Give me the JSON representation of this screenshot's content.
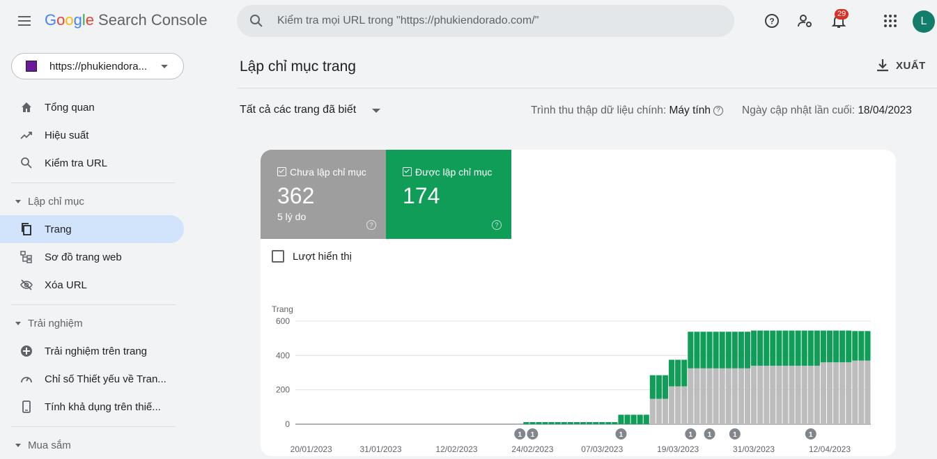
{
  "header": {
    "logo_google": [
      "G",
      "o",
      "o",
      "g",
      "l",
      "e"
    ],
    "logo_product": "Search Console",
    "search_placeholder": "Kiểm tra mọi URL trong \"https://phukiendorado.com/\"",
    "notification_count": "29",
    "avatar_letter": "L"
  },
  "sidebar": {
    "property": "https://phukiendora...",
    "items_top": [
      {
        "label": "Tổng quan",
        "icon": "home-icon"
      },
      {
        "label": "Hiệu suất",
        "icon": "trending-up-icon"
      },
      {
        "label": "Kiểm tra URL",
        "icon": "search-icon"
      }
    ],
    "section_index": "Lập chỉ mục",
    "items_index": [
      {
        "label": "Trang",
        "icon": "pages-icon"
      },
      {
        "label": "Sơ đồ trang web",
        "icon": "sitemap-icon"
      },
      {
        "label": "Xóa URL",
        "icon": "visibility-off-icon"
      }
    ],
    "section_experience": "Trải nghiệm",
    "items_experience": [
      {
        "label": "Trải nghiệm trên trang",
        "icon": "add-circle-icon"
      },
      {
        "label": "Chỉ số Thiết yếu về Tran...",
        "icon": "speed-icon"
      },
      {
        "label": "Tính khả dụng trên thiế...",
        "icon": "smartphone-icon"
      }
    ],
    "section_shopping": "Mua sắm"
  },
  "main": {
    "title": "Lập chỉ mục trang",
    "export_label": "XUẤT",
    "filter_label": "Tất cả các trang đã biết",
    "crawler_label": "Trình thu thập dữ liệu chính:",
    "crawler_value": "Máy tính",
    "updated_label": "Ngày cập nhật lần cuối:",
    "updated_value": "18/04/2023",
    "tiles": {
      "not_indexed": {
        "label": "Chưa lập chỉ mục",
        "value": "362",
        "sub": "5 lý do",
        "color": "#9e9e9e"
      },
      "indexed": {
        "label": "Được lập chỉ mục",
        "value": "174",
        "color": "#0f9d58"
      }
    },
    "impressions_label": "Lượt hiển thị"
  },
  "chart_data": {
    "type": "bar",
    "stacked": true,
    "ylabel": "Trang",
    "ylim": [
      0,
      600
    ],
    "yticks": [
      0,
      200,
      400,
      600
    ],
    "x_ticks": [
      "20/01/2023",
      "31/01/2023",
      "12/02/2023",
      "24/02/2023",
      "07/03/2023",
      "19/03/2023",
      "31/03/2023",
      "12/04/2023"
    ],
    "start_date": "2023-01-18",
    "end_date": "2023-04-18",
    "series": [
      {
        "name": "Chưa lập chỉ mục",
        "color": "#bdbdbd",
        "segments": [
          {
            "from": "2023-03-10",
            "to": "2023-03-14",
            "value": 0
          },
          {
            "from": "2023-03-15",
            "to": "2023-03-17",
            "value": 148
          },
          {
            "from": "2023-03-18",
            "to": "2023-03-20",
            "value": 220
          },
          {
            "from": "2023-03-21",
            "to": "2023-03-30",
            "value": 325
          },
          {
            "from": "2023-03-31",
            "to": "2023-04-10",
            "value": 340
          },
          {
            "from": "2023-04-11",
            "to": "2023-04-15",
            "value": 360
          },
          {
            "from": "2023-04-16",
            "to": "2023-04-18",
            "value": 370
          }
        ]
      },
      {
        "name": "Được lập chỉ mục",
        "color": "#0f9d58",
        "segments": [
          {
            "from": "2023-02-23",
            "to": "2023-03-09",
            "value": 12
          },
          {
            "from": "2023-03-10",
            "to": "2023-03-14",
            "value": 55
          },
          {
            "from": "2023-03-15",
            "to": "2023-03-17",
            "value": 137
          },
          {
            "from": "2023-03-18",
            "to": "2023-03-20",
            "value": 155
          },
          {
            "from": "2023-03-21",
            "to": "2023-03-30",
            "value": 213
          },
          {
            "from": "2023-03-31",
            "to": "2023-04-10",
            "value": 205
          },
          {
            "from": "2023-04-11",
            "to": "2023-04-15",
            "value": 185
          },
          {
            "from": "2023-04-16",
            "to": "2023-04-18",
            "value": 172
          }
        ]
      }
    ],
    "annotations": [
      {
        "date": "2023-02-22",
        "label": "1"
      },
      {
        "date": "2023-02-24",
        "label": "1"
      },
      {
        "date": "2023-03-10",
        "label": "1"
      },
      {
        "date": "2023-03-21",
        "label": "1"
      },
      {
        "date": "2023-03-24",
        "label": "1"
      },
      {
        "date": "2023-03-28",
        "label": "1"
      },
      {
        "date": "2023-04-09",
        "label": "1"
      }
    ]
  }
}
